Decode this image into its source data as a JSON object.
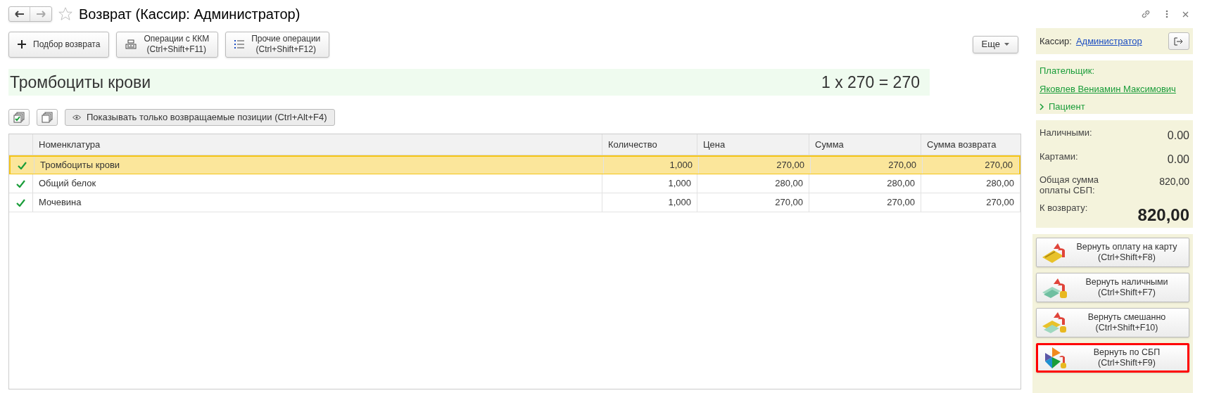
{
  "window": {
    "title": "Возврат (Кассир: Администратор)",
    "favorite": false
  },
  "toolbar": [
    {
      "kind": "plus",
      "label": "Подбор возврата"
    },
    {
      "kind": "register",
      "label": "Операции с ККМ\n(Ctrl+Shift+F11)"
    },
    {
      "kind": "list",
      "label": "Прочие операции\n(Ctrl+Shift+F12)"
    }
  ],
  "more_button": "Еще",
  "current_item": {
    "name": "Тромбоциты крови",
    "formula": "1 х 270 = 270"
  },
  "filter_button": "Показывать только возвращаемые позиции (Ctrl+Alt+F4)",
  "table": {
    "columns": [
      "Номенклатура",
      "Количество",
      "Цена",
      "Сумма",
      "Сумма возврата"
    ],
    "rows": [
      {
        "checked": true,
        "selected": true,
        "cells": [
          "Тромбоциты крови",
          "1,000",
          "270,00",
          "270,00",
          "270,00"
        ]
      },
      {
        "checked": true,
        "selected": false,
        "cells": [
          "Общий белок",
          "1,000",
          "280,00",
          "280,00",
          "280,00"
        ]
      },
      {
        "checked": true,
        "selected": false,
        "cells": [
          "Мочевина",
          "1,000",
          "270,00",
          "270,00",
          "270,00"
        ]
      }
    ]
  },
  "cashier": {
    "label": "Кассир:",
    "name": "Администратор"
  },
  "payer": {
    "label": "Плательщик:",
    "name": "Яковлев Вениамин Максимович",
    "section": "Пациент",
    "expanded": false
  },
  "totals": [
    {
      "label": "Наличными:",
      "value": "0.00",
      "emphasis": false
    },
    {
      "label": "Картами:",
      "value": "0.00",
      "emphasis": false
    },
    {
      "label": "Общая сумма оплаты СБП:",
      "value": "820,00",
      "emphasis": false
    },
    {
      "label": "К возврату:",
      "value": "820,00",
      "emphasis": true
    }
  ],
  "actions": [
    {
      "kind": "card",
      "label": "Вернуть оплату на карту\n(Ctrl+Shift+F8)",
      "focused": false
    },
    {
      "kind": "cash",
      "label": "Вернуть наличными\n(Ctrl+Shift+F7)",
      "focused": false
    },
    {
      "kind": "mixed",
      "label": "Вернуть смешанно\n(Ctrl+Shift+F10)",
      "focused": false
    },
    {
      "kind": "sbp",
      "label": "Вернуть по СБП\n(Ctrl+Shift+F9)",
      "focused": true
    }
  ]
}
